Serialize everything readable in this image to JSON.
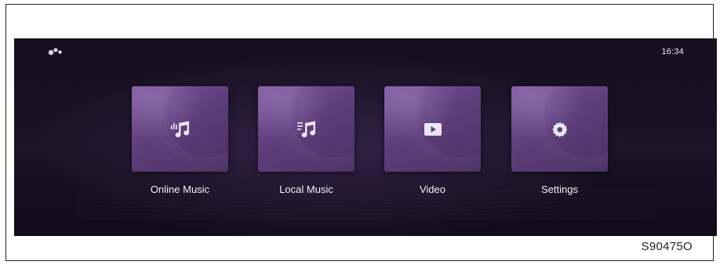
{
  "status_bar": {
    "logo_icon": "brand-logo-icon",
    "time": "16:34"
  },
  "tiles": [
    {
      "label": "Online Music",
      "icon": "online-music-icon"
    },
    {
      "label": "Local Music",
      "icon": "local-music-icon"
    },
    {
      "label": "Video",
      "icon": "video-play-icon"
    },
    {
      "label": "Settings",
      "icon": "gear-icon"
    }
  ],
  "figure_code": "S90475O",
  "colors": {
    "screen_background": "#1b1326",
    "tile_accent": "#6a4a8a",
    "text": "#f2f0f6"
  }
}
